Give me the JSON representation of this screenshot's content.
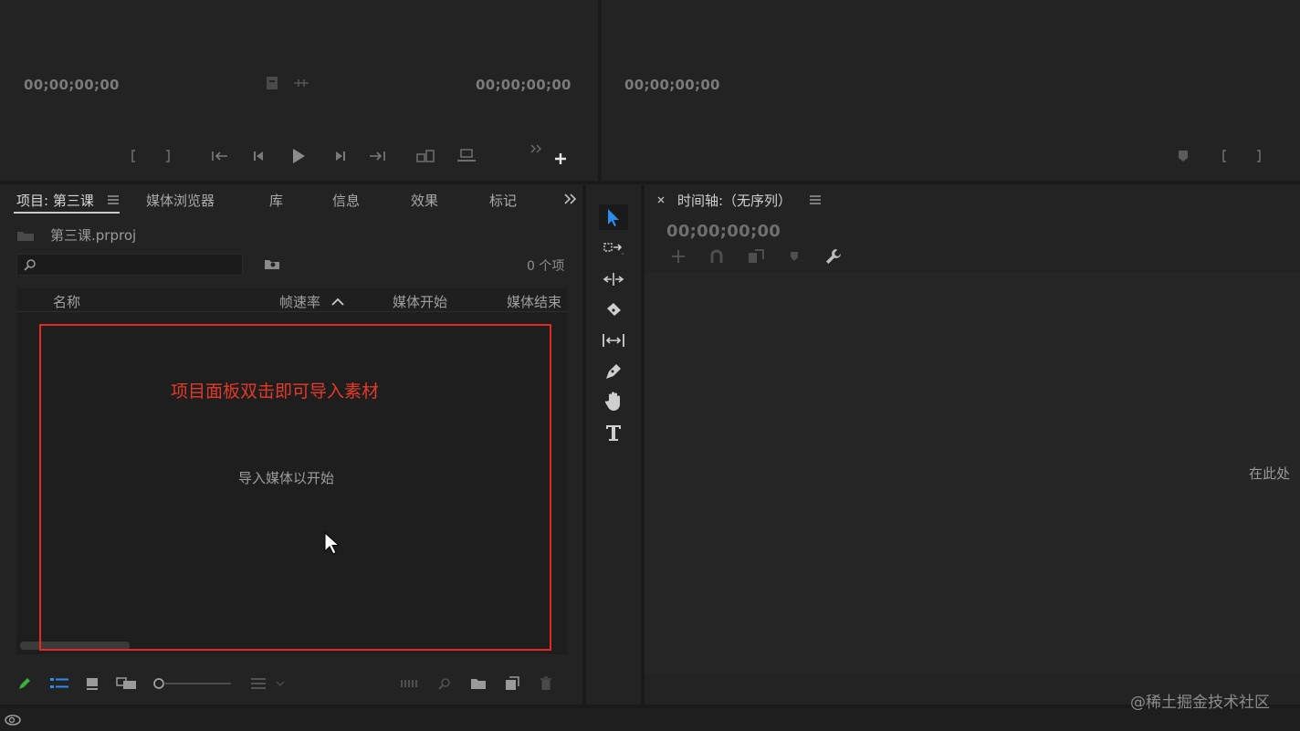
{
  "source_monitor": {
    "timecode_in": "00;00;00;00",
    "timecode_out": "00;00;00;00"
  },
  "program_monitor": {
    "timecode": "00;00;00;00"
  },
  "project_panel": {
    "tabs": [
      "项目: 第三课",
      "媒体浏览器",
      "库",
      "信息",
      "效果",
      "标记"
    ],
    "project_file": "第三课.prproj",
    "item_count": "0 个项",
    "search_placeholder": "",
    "columns": [
      "名称",
      "帧速率",
      "媒体开始",
      "媒体结束"
    ],
    "empty_message": "导入媒体以开始",
    "annotation": "项目面板双击即可导入素材"
  },
  "timeline_panel": {
    "title": "时间轴:（无序列）",
    "timecode": "00;00;00;00",
    "drop_hint": "在此处"
  },
  "watermark": "@稀土掘金技术社区",
  "colors": {
    "panel_bg": "#232323",
    "app_bg": "#1a1a1a",
    "annotation_red": "#e02a22",
    "selected_tool_blue": "#2d8ceb",
    "label_green": "#3fae3f"
  }
}
